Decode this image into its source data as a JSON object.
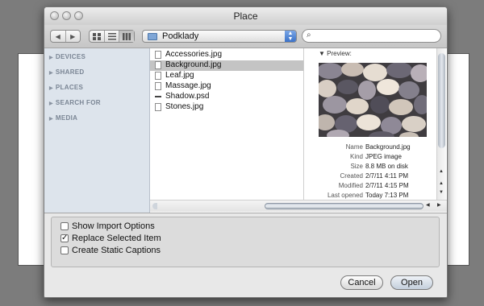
{
  "window": {
    "title": "Place"
  },
  "toolbar": {
    "nav": {
      "back": "◀",
      "forward": "▶"
    },
    "views": [
      "icons-view",
      "list-view",
      "column-view"
    ],
    "location": "Podklady",
    "search": {
      "value": "",
      "placeholder": ""
    }
  },
  "sidebar": {
    "sections": [
      {
        "label": "DEVICES"
      },
      {
        "label": "SHARED"
      },
      {
        "label": "PLACES"
      },
      {
        "label": "SEARCH FOR"
      },
      {
        "label": "MEDIA"
      }
    ]
  },
  "files": [
    {
      "name": "Accessories.jpg",
      "icon": "jpg-file-icon",
      "selected": false
    },
    {
      "name": "Background.jpg",
      "icon": "jpg-file-icon",
      "selected": true
    },
    {
      "name": "Leaf.jpg",
      "icon": "jpg-file-icon",
      "selected": false
    },
    {
      "name": "Massage.jpg",
      "icon": "jpg-file-icon",
      "selected": false
    },
    {
      "name": "Shadow.psd",
      "icon": "psd-file-icon",
      "selected": false
    },
    {
      "name": "Stones.jpg",
      "icon": "jpg-file-icon",
      "selected": false
    }
  ],
  "preview": {
    "header": "Preview:",
    "meta": [
      {
        "key": "Name",
        "value": "Background.jpg"
      },
      {
        "key": "Kind",
        "value": "JPEG image"
      },
      {
        "key": "Size",
        "value": "8.8 MB on disk"
      },
      {
        "key": "Created",
        "value": "2/7/11 4:11 PM"
      },
      {
        "key": "Modified",
        "value": "2/7/11 4:15 PM"
      },
      {
        "key": "Last opened",
        "value": "Today 7:13 PM"
      }
    ]
  },
  "options": [
    {
      "label": "Show Import Options",
      "checked": false
    },
    {
      "label": "Replace Selected Item",
      "checked": true
    },
    {
      "label": "Create Static Captions",
      "checked": false
    }
  ],
  "buttons": {
    "cancel": "Cancel",
    "open": "Open"
  },
  "colors": {
    "selection": "#c4c4c4",
    "sidebar": "#dde4ec",
    "accent": "#3b72c9"
  }
}
